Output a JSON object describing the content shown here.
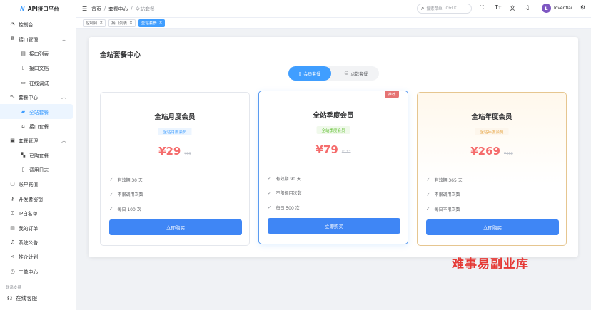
{
  "app": {
    "logo_mark": "N",
    "title": "API接口平台"
  },
  "sidebar": {
    "items": [
      {
        "label": "控制台",
        "icon": "dashboard-icon"
      },
      {
        "label": "接口管理",
        "icon": "interface-icon",
        "expanded": true
      },
      {
        "label": "接口列表",
        "icon": "list-icon"
      },
      {
        "label": "接口文档",
        "icon": "doc-icon"
      },
      {
        "label": "在线调试",
        "icon": "monitor-icon"
      },
      {
        "label": "套餐中心",
        "icon": "cart-icon",
        "expanded": true
      },
      {
        "label": "全站套餐",
        "icon": "bag-icon",
        "active": true
      },
      {
        "label": "接口套餐",
        "icon": "box-icon"
      },
      {
        "label": "套餐管理",
        "icon": "manage-icon",
        "expanded": true
      },
      {
        "label": "已购套餐",
        "icon": "ticket-icon"
      },
      {
        "label": "调用日志",
        "icon": "log-icon"
      },
      {
        "label": "账户充值",
        "icon": "wallet-icon"
      },
      {
        "label": "开发者密钥",
        "icon": "key-icon"
      },
      {
        "label": "IP白名单",
        "icon": "lock-icon"
      },
      {
        "label": "我的订单",
        "icon": "order-icon"
      },
      {
        "label": "系统公告",
        "icon": "bell-icon"
      },
      {
        "label": "推介计划",
        "icon": "share-icon"
      },
      {
        "label": "工单中心",
        "icon": "ticket-center-icon"
      }
    ],
    "group_title": "联系支持",
    "service_label": "在线客服"
  },
  "header": {
    "breadcrumb": [
      "首页",
      "套餐中心",
      "全站套餐"
    ],
    "search_placeholder": "搜索菜单",
    "search_shortcut": "Ctrl K",
    "user_initial": "L",
    "user_name": "lovenflai"
  },
  "tabs": [
    {
      "label": "控制台",
      "active": false
    },
    {
      "label": "接口列表",
      "active": false
    },
    {
      "label": "全站套餐",
      "active": true
    }
  ],
  "main": {
    "title": "全站套餐中心",
    "switch": {
      "member_label": "会员套餐",
      "points_label": "点数套餐",
      "selected": "member"
    },
    "plans": [
      {
        "name": "全站月度会员",
        "badge": "全站月度会员",
        "price": "¥29",
        "old_price": "¥39",
        "features": [
          "有效期 30 天",
          "不限调用次数",
          "每日 100 次"
        ],
        "button": "立即购买",
        "ribbon": ""
      },
      {
        "name": "全站季度会员",
        "badge": "全站季度会员",
        "price": "¥79",
        "old_price": "¥117",
        "features": [
          "有效期 90 天",
          "不限调用次数",
          "每日 500 次"
        ],
        "button": "立即购买",
        "ribbon": "推荐"
      },
      {
        "name": "全站年度会员",
        "badge": "全站年度会员",
        "price": "¥269",
        "old_price": "¥468",
        "features": [
          "有效期 365 天",
          "不限调用次数",
          "每日不限次数"
        ],
        "button": "立即购买",
        "ribbon": ""
      }
    ]
  },
  "watermark": "难事易副业库",
  "colors": {
    "primary": "#409eff",
    "price": "#f56c6c",
    "ribbon": "#e57373",
    "active_bg": "#ecf5ff"
  }
}
